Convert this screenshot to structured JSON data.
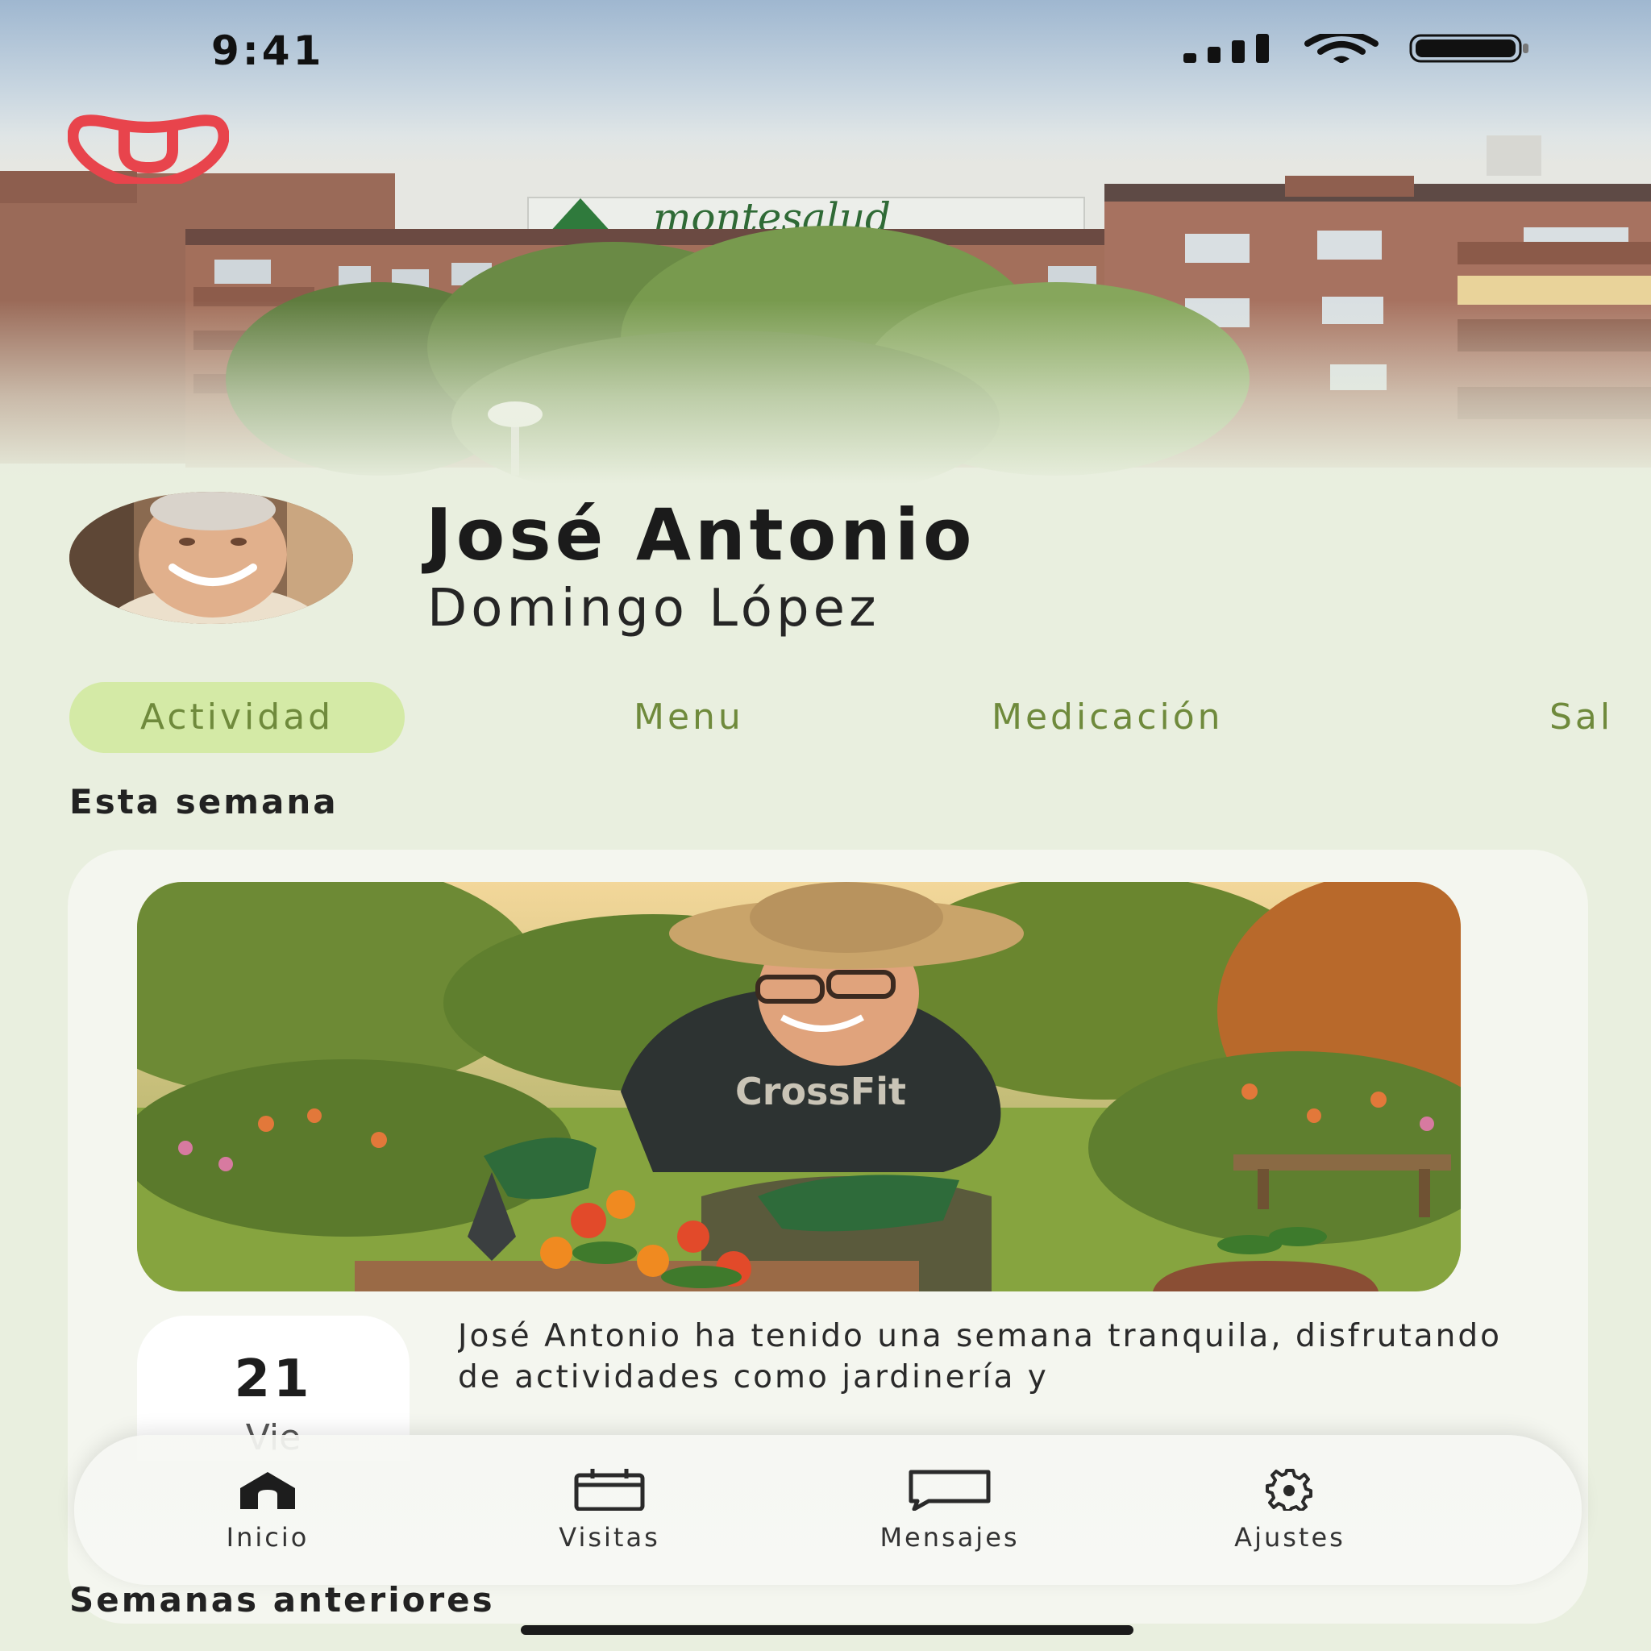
{
  "status_bar": {
    "time": "9:41"
  },
  "hero": {
    "building_sign": "montesalud"
  },
  "profile": {
    "first_name": "José Antonio",
    "last_name": "Domingo López"
  },
  "tabs": [
    {
      "label": "Actividad",
      "active": true
    },
    {
      "label": "Menu",
      "active": false
    },
    {
      "label": "Medicación",
      "active": false
    },
    {
      "label": "Sal",
      "active": false
    }
  ],
  "this_week": {
    "title": "Esta semana",
    "photo_shirt_text": "CrossFit",
    "date_day": "21",
    "date_weekday": "Vie",
    "summary": "José Antonio ha tenido una semana tranquila, disfrutando de actividades como jardinería y"
  },
  "bottom_nav": [
    {
      "label": "Inicio",
      "icon": "home-icon",
      "active": true
    },
    {
      "label": "Visitas",
      "icon": "calendar-icon",
      "active": false
    },
    {
      "label": "Mensajes",
      "icon": "message-icon",
      "active": false
    },
    {
      "label": "Ajustes",
      "icon": "gear-icon",
      "active": false
    }
  ],
  "previous_weeks": {
    "title": "Semanas anteriores"
  },
  "colors": {
    "background": "#e9efdf",
    "accent": "#6f8a3c",
    "tab_active_bg": "#d4eaa6",
    "logo_red": "#e8444c"
  }
}
